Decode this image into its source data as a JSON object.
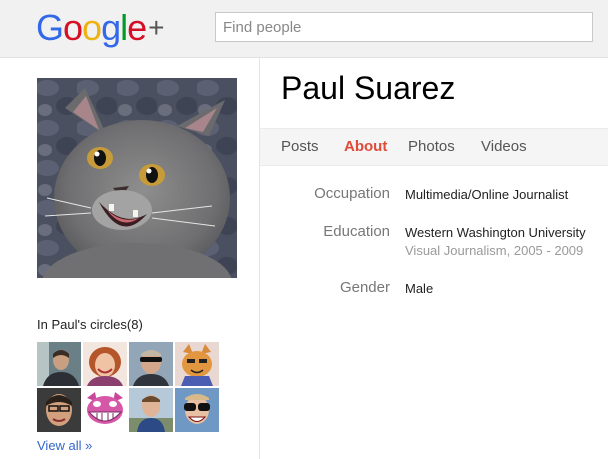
{
  "brand": {
    "letters": [
      {
        "ch": "G",
        "color": "#3369e8"
      },
      {
        "ch": "o",
        "color": "#d50f25"
      },
      {
        "ch": "o",
        "color": "#eeb211"
      },
      {
        "ch": "g",
        "color": "#3369e8"
      },
      {
        "ch": "l",
        "color": "#009925"
      },
      {
        "ch": "e",
        "color": "#d50f25"
      }
    ],
    "plus": "+"
  },
  "search": {
    "placeholder": "Find people",
    "value": ""
  },
  "profile": {
    "name": "Paul Suarez",
    "photo_icon": "cat-photo"
  },
  "tabs": [
    {
      "label": "Posts",
      "active": false
    },
    {
      "label": "About",
      "active": true
    },
    {
      "label": "Photos",
      "active": false
    },
    {
      "label": "Videos",
      "active": false
    }
  ],
  "about": {
    "occupation_label": "Occupation",
    "occupation_value": "Multimedia/Online Journalist",
    "education_label": "Education",
    "education_value": "Western Washington University",
    "education_detail": "Visual Journalism, 2005 - 2009",
    "gender_label": "Gender",
    "gender_value": "Male"
  },
  "circles": {
    "title": "In Paul's circles(8)",
    "view_all": "View all »",
    "people": [
      "person-1",
      "person-2",
      "person-3",
      "cat-drawing",
      "person-5",
      "cheshire-cat",
      "person-7",
      "person-8"
    ]
  },
  "colors": {
    "active_tab": "#dd4b39",
    "link": "#3366cc",
    "header_bg": "#f1f1f1"
  }
}
